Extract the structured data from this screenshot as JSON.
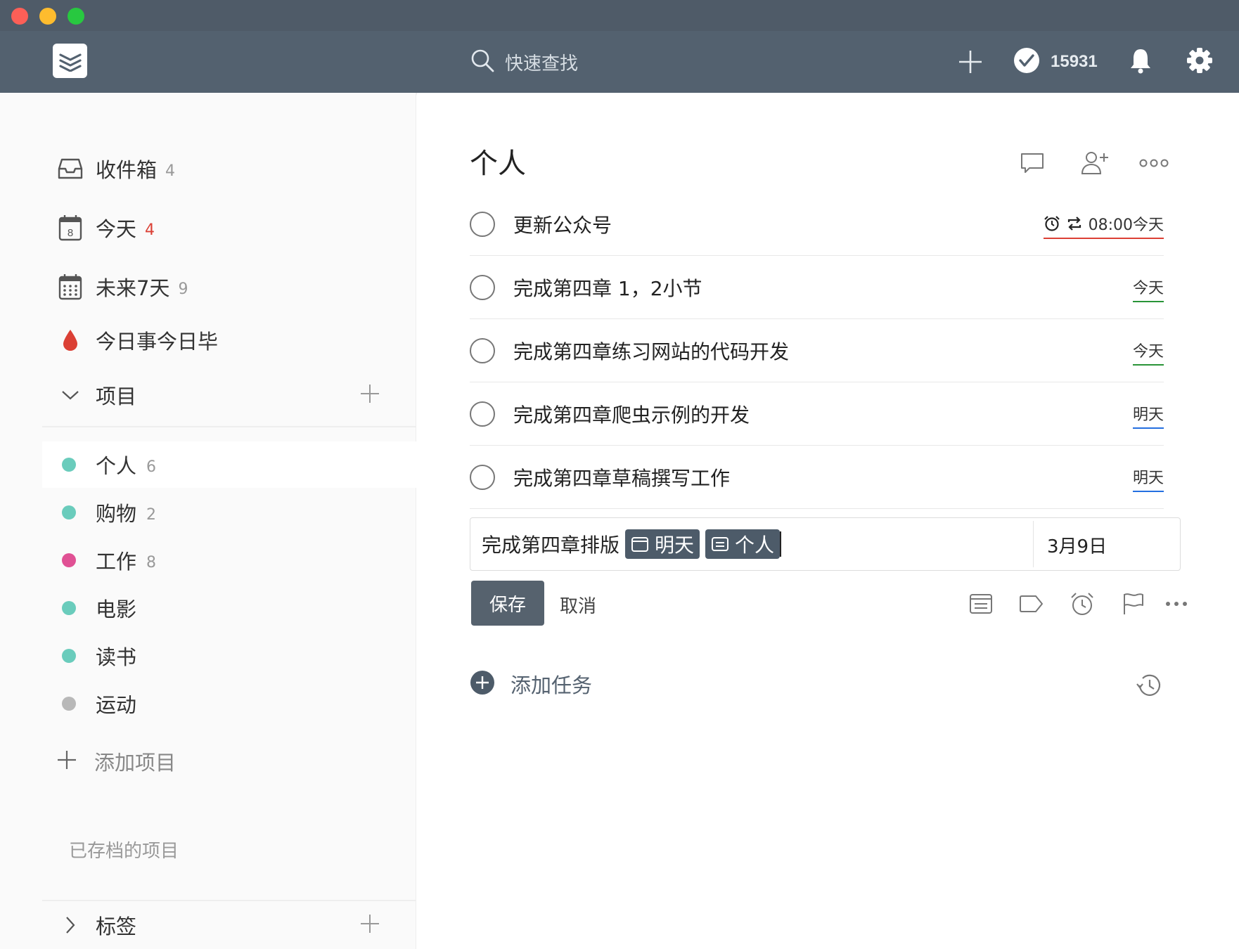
{
  "window": {
    "traffic_lights": [
      "close",
      "minimize",
      "zoom"
    ]
  },
  "topbar": {
    "search_placeholder": "快速查找",
    "karma_count": "15931",
    "icons": [
      "logo-icon",
      "search-icon",
      "add-icon",
      "karma-check-icon",
      "bell-icon",
      "gear-icon"
    ],
    "bg_color": "#53616f"
  },
  "sidebar": {
    "filters": [
      {
        "label": "收件箱",
        "count": "4",
        "icon": "inbox-icon"
      },
      {
        "label": "今天",
        "count": "4",
        "icon": "calendar-today-icon",
        "day": "8"
      },
      {
        "label": "未来7天",
        "count": "9",
        "icon": "calendar-week-icon"
      },
      {
        "label": "今日事今日毕",
        "count": "",
        "icon": "drop-icon"
      }
    ],
    "projects_header": "项目",
    "projects": [
      {
        "label": "个人",
        "count": "6",
        "color": "#6accbc"
      },
      {
        "label": "购物",
        "count": "2",
        "color": "#6accbc"
      },
      {
        "label": "工作",
        "count": "8",
        "color": "#e05194"
      },
      {
        "label": "电影",
        "count": "",
        "color": "#6accbc"
      },
      {
        "label": "读书",
        "count": "",
        "color": "#6accbc"
      },
      {
        "label": "运动",
        "count": "",
        "color": "#b8b8b8"
      }
    ],
    "add_project": "添加项目",
    "archived": "已存档的项目",
    "labels_header": "标签"
  },
  "main": {
    "title": "个人",
    "tasks": [
      {
        "label": "更新公众号",
        "due": "08:00今天",
        "due_style": "red",
        "has_alarm": true,
        "recurring": true
      },
      {
        "label": "完成第四章 1，2小节",
        "due": "今天",
        "due_style": "green"
      },
      {
        "label": "完成第四章练习网站的代码开发",
        "due": "今天",
        "due_style": "green"
      },
      {
        "label": "完成第四章爬虫示例的开发",
        "due": "明天",
        "due_style": "blue"
      },
      {
        "label": "完成第四章草稿撰写工作",
        "due": "明天",
        "due_style": "blue"
      }
    ],
    "editor": {
      "text": "完成第四章排版",
      "date_chip": "明天",
      "project_chip": "个人",
      "date_value": "3月9日"
    },
    "save": "保存",
    "cancel": "取消",
    "add_task": "添加任务"
  }
}
